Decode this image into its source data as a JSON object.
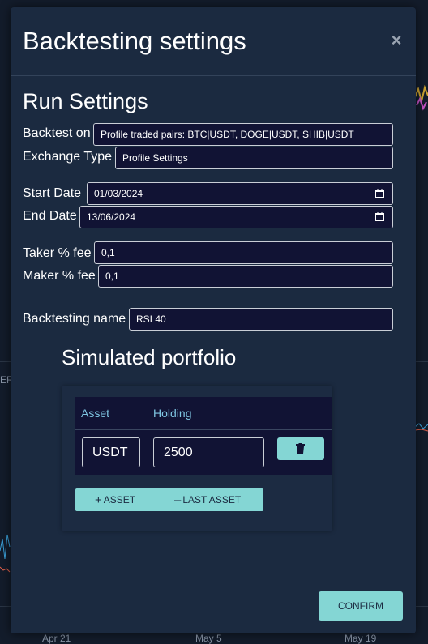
{
  "background": {
    "axis_labels": [
      "Apr 21",
      "May 5",
      "May 19"
    ],
    "left_clip_text": "ER"
  },
  "modal": {
    "title": "Backtesting settings",
    "close_glyph": "×",
    "run_settings": {
      "title": "Run Settings",
      "backtest_on": {
        "label": "Backtest on",
        "value": "Profile traded pairs: BTC|USDT, DOGE|USDT, SHIB|USDT"
      },
      "exchange_type": {
        "label": "Exchange Type",
        "value": "Profile Settings"
      },
      "start_date": {
        "label": "Start Date",
        "value": "01/03/2024"
      },
      "end_date": {
        "label": "End Date",
        "value": "13/06/2024"
      },
      "taker_fee": {
        "label": "Taker % fee",
        "value": "0,1"
      },
      "maker_fee": {
        "label": "Maker % fee",
        "value": "0,1"
      },
      "backtesting_name": {
        "label": "Backtesting name",
        "value": "RSI 40"
      }
    },
    "portfolio": {
      "title": "Simulated portfolio",
      "columns": [
        "Asset",
        "Holding"
      ],
      "rows": [
        {
          "asset": "USDT",
          "holding": "2500"
        }
      ],
      "add_asset_label": "ASSET",
      "remove_last_label": "LAST ASSET"
    },
    "confirm_label": "CONFIRM"
  },
  "colors": {
    "modal_bg": "#1b2a40",
    "field_bg": "#111334",
    "accent": "#84d6d4",
    "header_text": "#7fc6e2"
  }
}
